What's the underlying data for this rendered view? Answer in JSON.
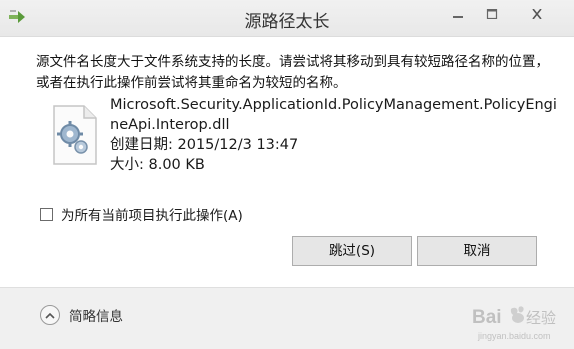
{
  "window": {
    "title": "源路径太长",
    "controls": {
      "minimize_icon": "minimize-icon",
      "maximize_icon": "maximize-icon",
      "close_icon": "close-icon"
    }
  },
  "message": "源文件名长度大于文件系统支持的长度。请尝试将其移动到具有较短路径名称的位置，或者在执行此操作前尝试将其重命名为较短的名称。",
  "file": {
    "name": "Microsoft.Security.ApplicationId.PolicyManagement.PolicyEngineApi.Interop.dll",
    "created": "创建日期: 2015/12/3 13:47",
    "size": "大小: 8.00 KB",
    "icon": "dll-file-gear-icon"
  },
  "apply_all": {
    "label": "为所有当前项目执行此操作(A)",
    "checked": false
  },
  "buttons": {
    "skip": "跳过(S)",
    "cancel": "取消"
  },
  "footer": {
    "toggle_label": "简略信息",
    "toggle_icon": "chevron-up-icon"
  },
  "watermark": {
    "text": "Baidu经验",
    "subtext": "jingyan.baidu.com"
  },
  "colors": {
    "titlebar": "#ececec",
    "button_bg": "#e6e6e6",
    "footer_bg": "#f0f0f0"
  }
}
